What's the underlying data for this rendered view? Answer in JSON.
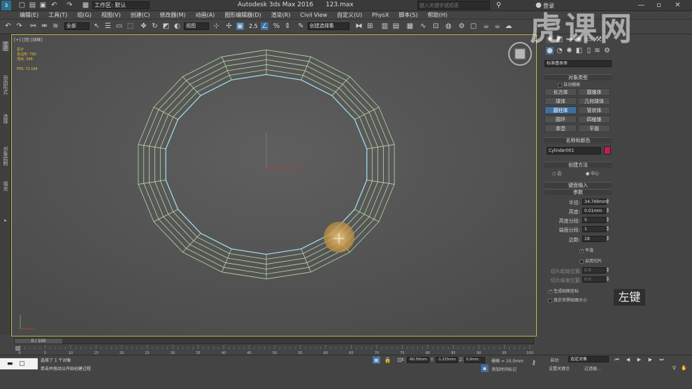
{
  "titlebar": {
    "workspace_label": "工作区: 默认",
    "app_title": "Autodesk 3ds Max 2016",
    "file_name": "123.max",
    "search_placeholder": "键入关键字或短语",
    "login_label": "登录"
  },
  "menu": [
    "编辑(E)",
    "工具(T)",
    "组(G)",
    "视图(V)",
    "创建(C)",
    "修改器(M)",
    "动画(A)",
    "图形编辑器(D)",
    "渲染(R)",
    "Civil View",
    "自定义(U)",
    "PhysX",
    "脚本(S)",
    "帮助(H)"
  ],
  "toolbar": {
    "selection_filter": "全部",
    "reference_coord": "视图",
    "named_selection": "创建选择集",
    "snap_value": "2.5"
  },
  "left_strip": [
    "建模",
    "自由形式",
    "选择",
    "对象绘制",
    "填充"
  ],
  "viewport": {
    "label": "[+] [顶] [线框]",
    "stats": [
      {
        "label": "总计",
        "value": ""
      },
      {
        "label": "多边形:",
        "value": "792"
      },
      {
        "label": "顶点:",
        "value": "396"
      }
    ],
    "fps_label": "FPS:",
    "fps_value": "72.194"
  },
  "command_panel": {
    "category": "标准基本体",
    "object_type_header": "对象类型",
    "autogrid_label": "自动栅格",
    "buttons": [
      "长方体",
      "圆锥体",
      "球体",
      "几何球体",
      "圆柱体",
      "管状体",
      "圆环",
      "四棱锥",
      "茶壶",
      "平面"
    ],
    "active_button": "圆柱体",
    "name_color_header": "名称和颜色",
    "object_name": "Cylinder001",
    "object_color": "#c01a5a",
    "creation_method_header": "创建方法",
    "creation_edge": "边",
    "creation_center": "中心",
    "keyboard_entry_header": "键盘输入",
    "parameters_header": "参数",
    "params": [
      {
        "label": "半径:",
        "value": "34.769mm"
      },
      {
        "label": "高度:",
        "value": "0.01mm"
      },
      {
        "label": "高度分段:",
        "value": "5"
      },
      {
        "label": "端面分段:",
        "value": "1"
      },
      {
        "label": "边数:",
        "value": "18"
      }
    ],
    "smooth_label": "平滑",
    "slice_on_label": "启用切片",
    "slice_from_label": "切片起始位置:",
    "slice_from_value": "0.0",
    "slice_to_label": "切片结束位置:",
    "slice_to_value": "0.0",
    "gen_uv_label": "生成贴图坐标",
    "real_world_label": "真实世界贴图大小"
  },
  "tooltip_text": "左键",
  "watermark_text": "虎课网",
  "timeline": {
    "frame_label": "0 / 100",
    "ticks": [
      "0",
      "5",
      "10",
      "15",
      "20",
      "25",
      "30",
      "35",
      "40",
      "45",
      "50",
      "55",
      "60",
      "65",
      "70",
      "75",
      "80",
      "85",
      "90",
      "95",
      "100"
    ]
  },
  "status": {
    "selection_text": "选择了 1 个对象",
    "prompt_text": "单击并拖动以开始创建过程",
    "x_label": "X:",
    "x_value": "-60.50mm",
    "y_label": "Y:",
    "y_value": "-1.215mm",
    "z_label": "Z:",
    "z_value": "0.0mm",
    "grid_label": "栅格 = 10.0mm",
    "add_time_tag": "添加时间标记",
    "auto_label": "自动",
    "selected_object": "选定对象",
    "set_key_label": "设置关键点",
    "filter_label": "过滤器..."
  }
}
